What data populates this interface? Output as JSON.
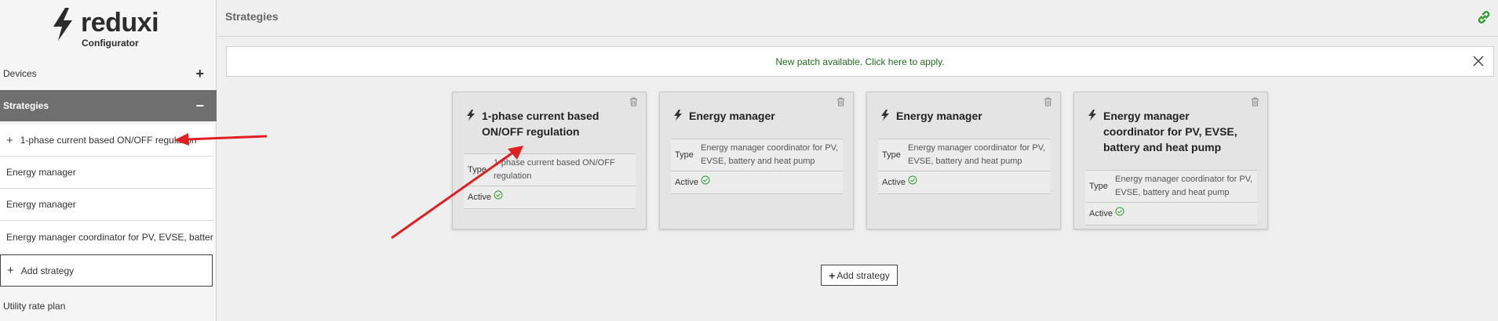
{
  "app": {
    "brand": "reduxi",
    "subtitle": "Configurator"
  },
  "sidebar": {
    "sections": [
      {
        "label": "Devices",
        "sign": "+"
      },
      {
        "label": "Strategies",
        "sign": "−"
      }
    ],
    "strategy_items": [
      {
        "label": "1-phase current based ON/OFF regulation",
        "icon": "plus-icon"
      },
      {
        "label": "Energy manager"
      },
      {
        "label": "Energy manager"
      },
      {
        "label": "Energy manager coordinator for PV, EVSE, battery and heat pump"
      }
    ],
    "add_strategy_label": "Add strategy",
    "utility_label": "Utility rate plan"
  },
  "header": {
    "title": "Strategies",
    "link_icon": "link-icon"
  },
  "notice": {
    "message": "New patch available. Click here to apply.",
    "close_icon": "close-icon"
  },
  "cards": [
    {
      "title": "1-phase current based ON/OFF regulation",
      "type_label": "Type",
      "type_value": "1-phase current based ON/OFF regulation",
      "active_label": "Active",
      "active": true
    },
    {
      "title": "Energy manager",
      "type_label": "Type",
      "type_value": "Energy manager coordinator for PV, EVSE, battery and heat pump",
      "active_label": "Active",
      "active": true
    },
    {
      "title": "Energy manager",
      "type_label": "Type",
      "type_value": "Energy manager coordinator for PV, EVSE, battery and heat pump",
      "active_label": "Active",
      "active": true
    },
    {
      "title": "Energy manager coordinator for PV, EVSE, battery and heat pump",
      "type_label": "Type",
      "type_value": "Energy manager coordinator for PV, EVSE, battery and heat pump",
      "active_label": "Active",
      "active": true
    }
  ],
  "add_button_label": "Add strategy",
  "colors": {
    "accent_green": "#2e9e2e",
    "annotation_red": "#e02020",
    "active_nav": "#6f6f6f"
  }
}
